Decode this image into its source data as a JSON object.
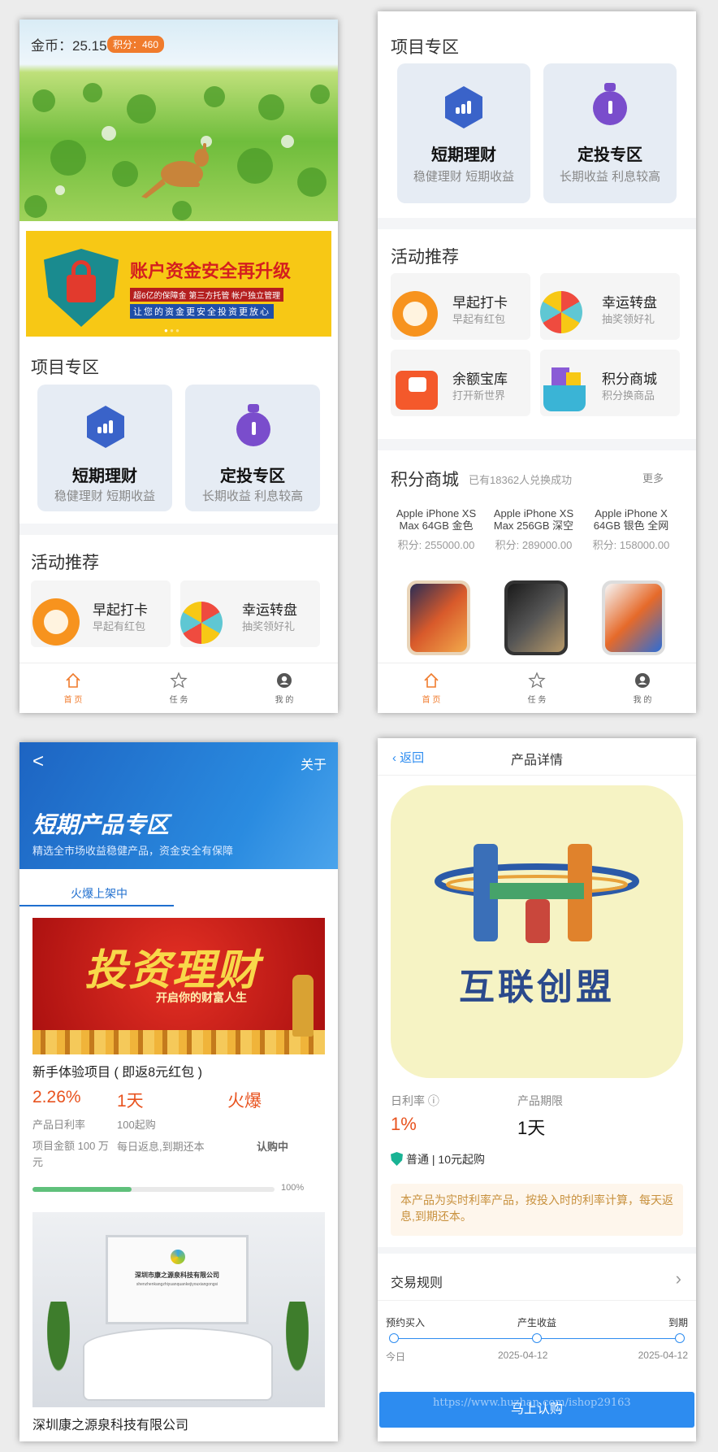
{
  "screens": {
    "home": {
      "coins_label": "金币：25.15",
      "points_badge": "积分：460",
      "banner": {
        "title": "账户资金安全再升级",
        "line1": "超6亿的保障金  第三方托管  帐户独立管理",
        "line2": "让您的资金更安全投资更放心"
      },
      "section_projects": "项目专区",
      "section_activities": "活动推荐"
    },
    "mall": {
      "section_projects": "项目专区",
      "section_activities": "活动推荐",
      "section_mall": "积分商城",
      "mall_sub": "已有18362人兑换成功",
      "more": "更多"
    },
    "list": {
      "back_label": "<",
      "about": "关于",
      "hero_title": "短期产品专区",
      "hero_sub": "精选全市场收益稳健产品，资金安全有保障",
      "tab_active": "火爆上架中",
      "banner_text": "投资理财",
      "banner_sub": "开启你的财富人生",
      "item1": {
        "title": "新手体验项目 ( 即返8元红包 )",
        "rate": "2.26%",
        "rate_label": "产品日利率",
        "term": "1天",
        "min_label": "100起购",
        "hot": "火爆",
        "amount": "项目金额 100 万元",
        "repay": "每日返息,到期还本",
        "status": "认购中",
        "progress": 0.41,
        "progress_label": "100%"
      },
      "item2": {
        "title": "深圳康之源泉科技有限公司",
        "sign_cn": "深圳市康之源泉科技有限公司",
        "sign_en": "shenzhenkangzhiyuanquankejiyouxiangongsi"
      }
    },
    "detail": {
      "back": "返回",
      "title": "产品详情",
      "logo_text": "互联创盟",
      "rate_label": "日利率",
      "rate": "1%",
      "term_label": "产品期限",
      "term": "1天",
      "tag": "普通 | 10元起购",
      "notice": "本产品为实时利率产品，按投入时的利率计算，每天返息,到期还本。",
      "rules": "交易规则",
      "timeline": {
        "steps": [
          "预约买入",
          "产生收益",
          "到期"
        ],
        "dates": [
          "今日",
          "2025-04-12",
          "2025-04-12"
        ]
      },
      "buy_button": "马上认购",
      "watermark": "https://www.huzhan.com/ishop29163"
    }
  },
  "project_cards": [
    {
      "title": "短期理财",
      "sub": "稳健理财 短期收益",
      "icon": "chart-hexagon-icon"
    },
    {
      "title": "定投专区",
      "sub": "长期收益 利息较高",
      "icon": "stopwatch-icon"
    }
  ],
  "activities": [
    {
      "name": "早起打卡",
      "desc": "早起有红包",
      "icon": "alarm-clock-icon"
    },
    {
      "name": "幸运转盘",
      "desc": "抽奖领好礼",
      "icon": "prize-wheel-icon"
    },
    {
      "name": "余额宝库",
      "desc": "打开新世界",
      "icon": "wallet-icon"
    },
    {
      "name": "积分商城",
      "desc": "积分换商品",
      "icon": "gift-basket-icon"
    }
  ],
  "products": [
    {
      "name": "Apple iPhone XS Max 64GB 金色",
      "price": "积分: 255000.00"
    },
    {
      "name": "Apple iPhone XS Max 256GB 深空",
      "price": "积分: 289000.00"
    },
    {
      "name": "Apple iPhone X 64GB 银色 全网",
      "price": "积分: 158000.00"
    }
  ],
  "tabbar": [
    {
      "label": "首 页",
      "icon": "home-icon"
    },
    {
      "label": "任 务",
      "icon": "star-icon"
    },
    {
      "label": "我 的",
      "icon": "user-icon"
    }
  ],
  "colors": {
    "accent": "#f07b2c",
    "blue": "#2d8cf0",
    "brand_blue": "#1f6fcf",
    "rate_red": "#e8531f"
  }
}
